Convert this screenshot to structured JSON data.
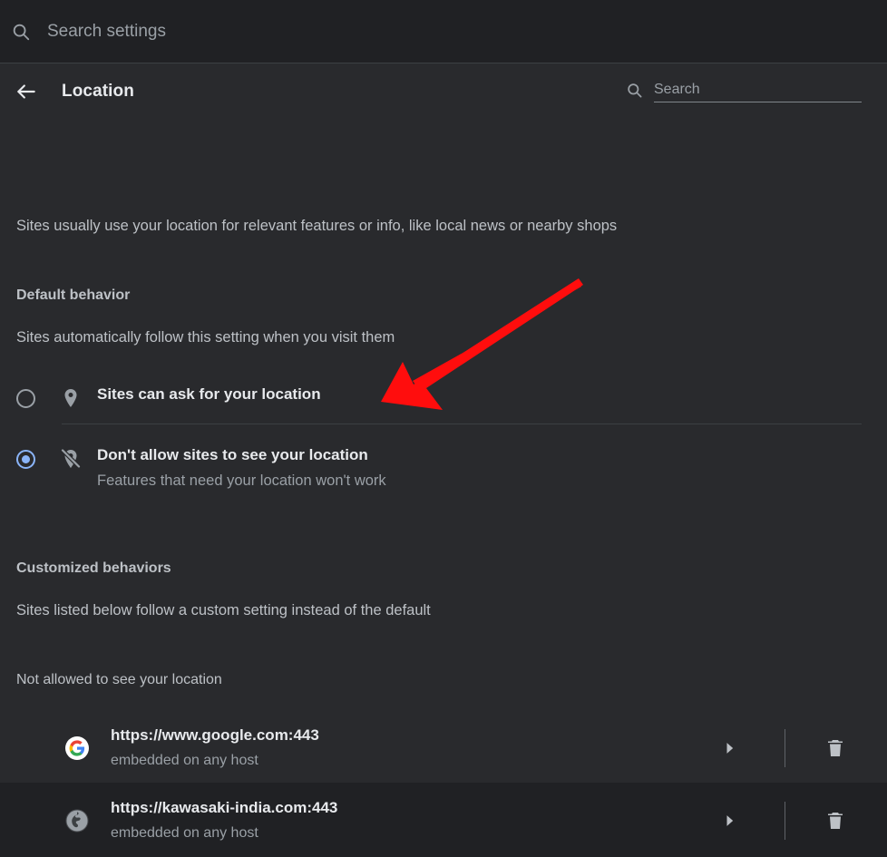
{
  "topbar": {
    "search_icon": "search-icon",
    "search_placeholder": "Search settings",
    "search_value": ""
  },
  "subheader": {
    "back_icon": "back-arrow-icon",
    "title": "Location",
    "search_icon": "search-icon",
    "search_placeholder": "Search",
    "search_value": ""
  },
  "page": {
    "intro": "Sites usually use your location for relevant features or info, like local news or nearby shops"
  },
  "default_behavior": {
    "heading": "Default behavior",
    "description": "Sites automatically follow this setting when you visit them",
    "options": [
      {
        "icon": "location-pin-icon",
        "label": "Sites can ask for your location",
        "description": "",
        "selected": false
      },
      {
        "icon": "location-pin-off-icon",
        "label": "Don't allow sites to see your location",
        "description": "Features that need your location won't work",
        "selected": true
      }
    ]
  },
  "customized_behaviors": {
    "heading": "Customized behaviors",
    "description": "Sites listed below follow a custom setting instead of the default",
    "not_allowed_label": "Not allowed to see your location",
    "sites": [
      {
        "favicon": "google-logo-icon",
        "url": "https://www.google.com:443",
        "detail": "embedded on any host",
        "expand_icon": "chevron-right-icon",
        "delete_icon": "trash-icon"
      },
      {
        "favicon": "globe-icon",
        "url": "https://kawasaki-india.com:443",
        "detail": "embedded on any host",
        "expand_icon": "chevron-right-icon",
        "delete_icon": "trash-icon"
      }
    ]
  },
  "annotation": {
    "type": "arrow",
    "color": "#FF0D0D",
    "points_to": "Don't allow sites to see your location"
  },
  "colors": {
    "topbar_bg": "#202124",
    "content_bg": "#292a2d",
    "accent": "#8ab4f8",
    "primary_text": "#e8eaed",
    "secondary_text": "#9aa0a6"
  }
}
